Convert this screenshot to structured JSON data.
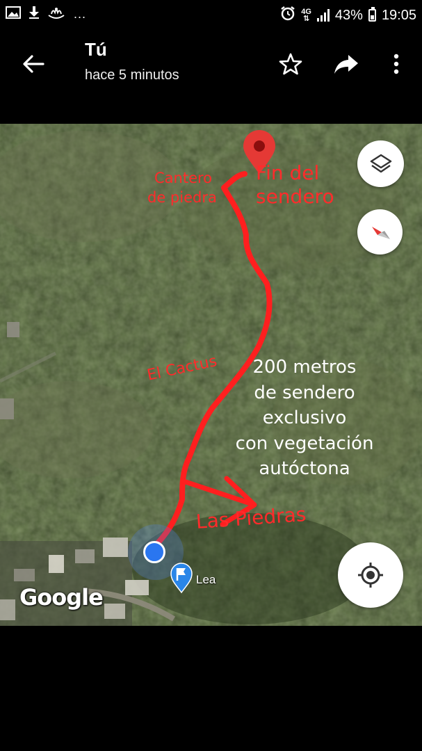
{
  "status_bar": {
    "icons_left": [
      "image-icon",
      "download-icon",
      "app-notification-icon"
    ],
    "ellipsis": "...",
    "network_label": "4G",
    "battery": "43%",
    "battery_level": 0.43,
    "time": "19:05"
  },
  "app_bar": {
    "title": "Tú",
    "subtitle": "hace 5 minutos"
  },
  "map": {
    "annotations": {
      "fin_line1": "Fin del",
      "fin_line2": "sendero",
      "cantero_line1": "Cantero",
      "cantero_line2": "de piedra",
      "cactus": "El Cactus",
      "piedras": "Las Piedras",
      "description": [
        "200 metros",
        "de sendero",
        "exclusivo",
        "con vegetación",
        "autóctona"
      ]
    },
    "annotation_color": "#ff2b2b",
    "place_label": "Lea",
    "attribution": "Google",
    "my_location_color": "#2a76f0",
    "destination_pin_color": "#e53935"
  }
}
